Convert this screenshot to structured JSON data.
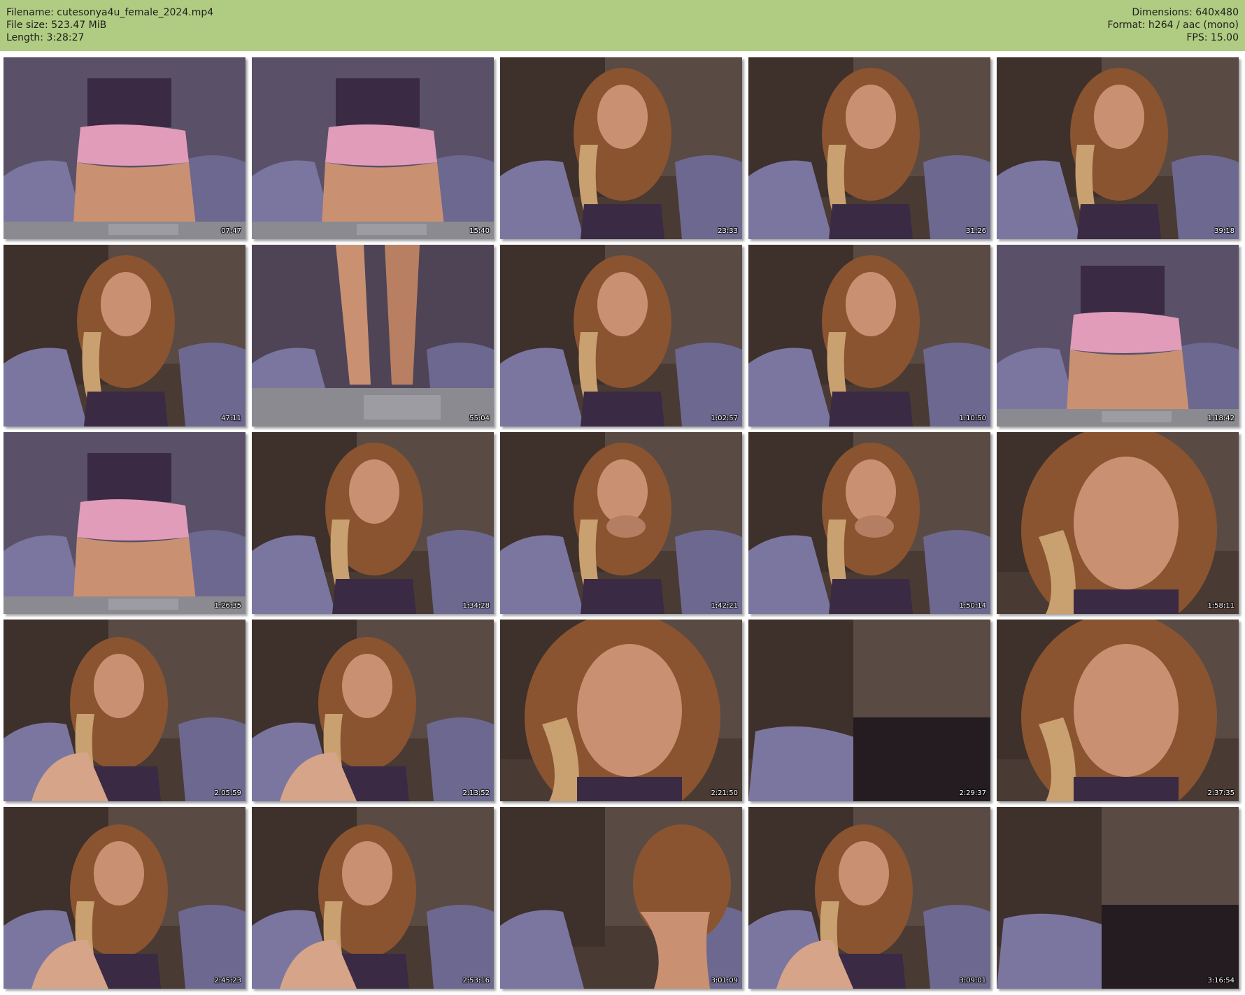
{
  "header": {
    "filename_line": "Filename: cutesonya4u_female_2024.mp4",
    "filesize_line": "File size: 523.47 MiB",
    "length_line": "Length: 3:28:27",
    "dimensions_line": "Dimensions: 640x480",
    "format_line": "Format: h264 / aac (mono)",
    "fps_line": "FPS: 15.00",
    "background_color": "#b0cc82"
  },
  "thumbnails": [
    {
      "timestamp": "07:47",
      "scene": "lap"
    },
    {
      "timestamp": "15:40",
      "scene": "lap"
    },
    {
      "timestamp": "23:33",
      "scene": "face"
    },
    {
      "timestamp": "31:26",
      "scene": "face"
    },
    {
      "timestamp": "39:18",
      "scene": "face"
    },
    {
      "timestamp": "47:11",
      "scene": "face"
    },
    {
      "timestamp": "55:04",
      "scene": "legs"
    },
    {
      "timestamp": "1:02:57",
      "scene": "face"
    },
    {
      "timestamp": "1:10:50",
      "scene": "face"
    },
    {
      "timestamp": "1:18:42",
      "scene": "lap"
    },
    {
      "timestamp": "1:26:35",
      "scene": "lap"
    },
    {
      "timestamp": "1:34:28",
      "scene": "face"
    },
    {
      "timestamp": "1:42:21",
      "scene": "phone"
    },
    {
      "timestamp": "1:50:14",
      "scene": "phone"
    },
    {
      "timestamp": "1:58:11",
      "scene": "closeup"
    },
    {
      "timestamp": "2:05:59",
      "scene": "sitting"
    },
    {
      "timestamp": "2:13:52",
      "scene": "sitting"
    },
    {
      "timestamp": "2:21:50",
      "scene": "closeup"
    },
    {
      "timestamp": "2:29:37",
      "scene": "empty"
    },
    {
      "timestamp": "2:37:35",
      "scene": "closeup"
    },
    {
      "timestamp": "2:45:23",
      "scene": "sitting"
    },
    {
      "timestamp": "2:53:16",
      "scene": "sitting"
    },
    {
      "timestamp": "3:01:09",
      "scene": "leaning"
    },
    {
      "timestamp": "3:09:01",
      "scene": "sitting"
    },
    {
      "timestamp": "3:16:54",
      "scene": "empty"
    }
  ]
}
